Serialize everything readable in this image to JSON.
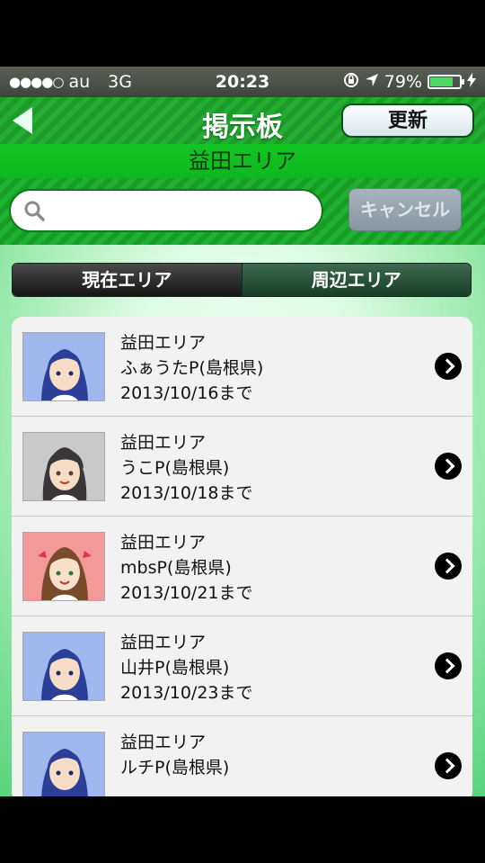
{
  "status": {
    "carrier": "au",
    "network": "3G",
    "time": "20:23",
    "battery": "79%",
    "battery_level": 0.79
  },
  "nav": {
    "title": "掲示板",
    "refresh_label": "更新"
  },
  "area_banner": "益田エリア",
  "search": {
    "placeholder": "",
    "cancel_label": "キャンセル"
  },
  "segments": [
    "現在エリア",
    "周辺エリア"
  ],
  "list": [
    {
      "area": "益田エリア",
      "name": "ふぁうたP(島根県)",
      "date": "2013/10/16まで",
      "avatar": "blue-hair-girl"
    },
    {
      "area": "益田エリア",
      "name": "うこP(島根県)",
      "date": "2013/10/18まで",
      "avatar": "gray-hair-girl"
    },
    {
      "area": "益田エリア",
      "name": "mbsP(島根県)",
      "date": "2013/10/21まで",
      "avatar": "brown-hair-girl"
    },
    {
      "area": "益田エリア",
      "name": "山井P(島根県)",
      "date": "2013/10/23まで",
      "avatar": "blue-hair-girl"
    },
    {
      "area": "益田エリア",
      "name": "ルチP(島根県)",
      "date": "",
      "avatar": "blue-hair-girl"
    }
  ],
  "colors": {
    "nav_green": "#1fa62e",
    "banner_green": "#13c523",
    "list_bg": "#f2f2f2"
  }
}
